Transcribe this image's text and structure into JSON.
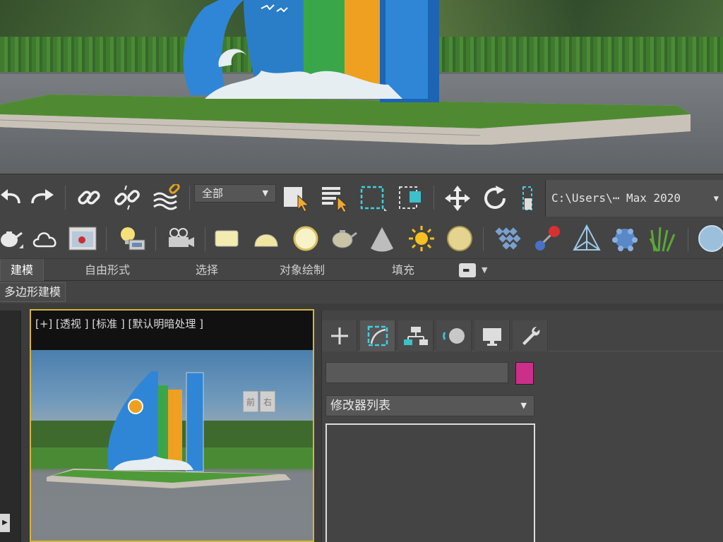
{
  "toolbar": {
    "selection_filter": "全部",
    "project_path": "C:\\Users\\⋯ Max 2020",
    "icons_row1": [
      "undo-icon",
      "redo-icon",
      "link-icon",
      "unlink-icon",
      "bind-spacewarp-icon",
      "select-object-icon",
      "select-by-name-icon",
      "rectangular-selection-icon",
      "window-crossing-icon",
      "move-icon",
      "rotate-icon",
      "scale-icon"
    ],
    "icons_row2": [
      "teapot-icon",
      "cloud-icon",
      "render-frame-icon",
      "light-icon",
      "camera-icon",
      "plane-material-icon",
      "dome-icon",
      "sphere-light-icon",
      "teapot-material-icon",
      "cone-icon",
      "sun-icon",
      "ball-material-icon",
      "grid-icon",
      "particles-icon",
      "pyramid-icon",
      "foliage-ball-icon",
      "grass-icon",
      "sphere-icon"
    ]
  },
  "ribbon": {
    "tabs": [
      "建模",
      "自由形式",
      "选择",
      "对象绘制",
      "填充"
    ],
    "active_tab": "建模",
    "sub_tab": "多边形建模"
  },
  "viewport": {
    "label": "[+] [透视 ] [标准 ] [默认明暗处理 ]",
    "viewcube_front": "前",
    "viewcube_right": "右"
  },
  "command_panel": {
    "tabs": [
      "create-tab",
      "modify-tab",
      "hierarchy-tab",
      "motion-tab",
      "display-tab",
      "utilities-tab"
    ],
    "active_tab": "modify-tab",
    "modifier_list": "修改器列表",
    "color_swatch": "#cc2f8a"
  },
  "scene": {
    "sign_colors": [
      "#2f86d6",
      "#3aa64a",
      "#f0a020",
      "#1e64b4"
    ]
  }
}
